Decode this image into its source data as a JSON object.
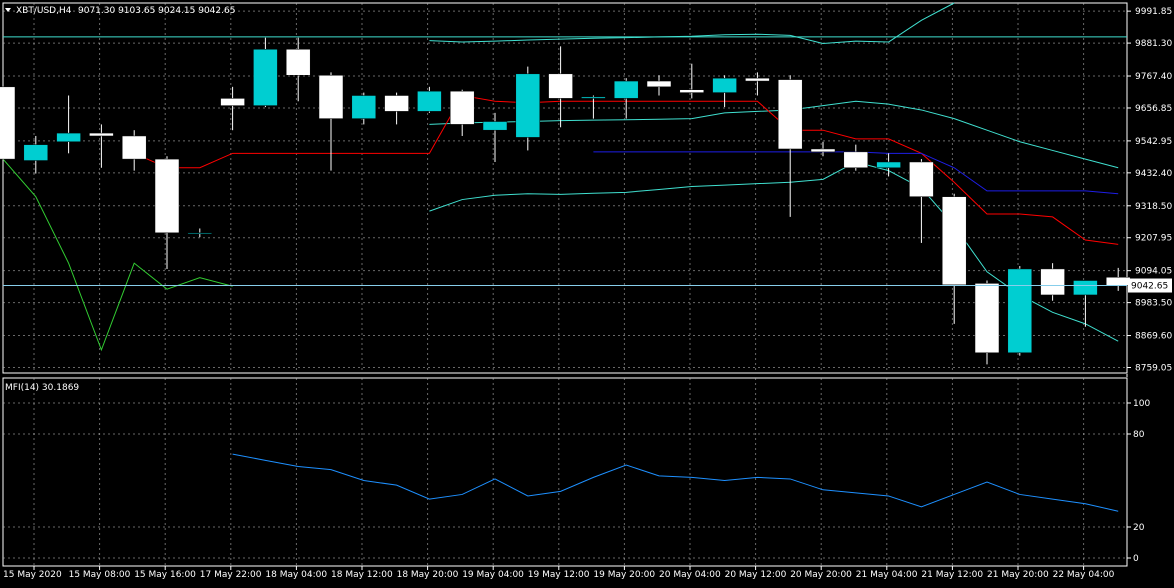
{
  "header": {
    "symbol": "XBT/USD,H4",
    "ohlc": "9071.30 9103.65 9024.15 9042.65",
    "menu_icon": "triangle-down-icon"
  },
  "indicator": {
    "label": "MFI(14) 30.1869",
    "levels": [
      100,
      80,
      20,
      0
    ],
    "level_labels": [
      "100",
      "80",
      "20",
      "0"
    ]
  },
  "colors": {
    "background": "#000000",
    "grid": "#c0c0c0",
    "candle_up": "#00ced1",
    "candle_down": "#ffffff",
    "bollinger": "#40e0d0",
    "lime_line": "#32cd32",
    "red_line": "#ff0000",
    "blue_line": "#1e1ee6",
    "mfi_line": "#1e90ff",
    "current_price_line": "#87ceeb"
  },
  "chart_data": [
    {
      "type": "candlestick",
      "title": "XBT/USD,H4",
      "ylim": [
        8740,
        10020
      ],
      "y_ticks": [
        "9991.85",
        "9881.30",
        "9767.40",
        "9656.85",
        "9542.95",
        "9432.40",
        "9318.50",
        "9207.95",
        "9094.05",
        "8983.50",
        "8869.60",
        "8759.05"
      ],
      "current_price": "9042.65",
      "x_ticks": [
        "15 May 2020",
        "15 May 08:00",
        "15 May 16:00",
        "17 May 22:00",
        "18 May 04:00",
        "18 May 12:00",
        "18 May 20:00",
        "19 May 04:00",
        "19 May 12:00",
        "19 May 20:00",
        "20 May 04:00",
        "20 May 12:00",
        "20 May 20:00",
        "21 May 04:00",
        "21 May 12:00",
        "21 May 20:00",
        "22 May 04:00"
      ],
      "candles": [
        {
          "o": 9730,
          "h": 9750,
          "l": 9460,
          "c": 9480
        },
        {
          "o": 9475,
          "h": 9560,
          "l": 9430,
          "c": 9530
        },
        {
          "o": 9540,
          "h": 9700,
          "l": 9500,
          "c": 9570
        },
        {
          "o": 9570,
          "h": 9600,
          "l": 9450,
          "c": 9560
        },
        {
          "o": 9560,
          "h": 9580,
          "l": 9440,
          "c": 9480
        },
        {
          "o": 9480,
          "h": 9490,
          "l": 9100,
          "c": 9225
        },
        {
          "o": 9225,
          "h": 9240,
          "l": 9210,
          "c": 9225
        },
        {
          "o": 9690,
          "h": 9730,
          "l": 9580,
          "c": 9665
        },
        {
          "o": 9665,
          "h": 9900,
          "l": 9660,
          "c": 9860
        },
        {
          "o": 9860,
          "h": 9900,
          "l": 9680,
          "c": 9770
        },
        {
          "o": 9770,
          "h": 9780,
          "l": 9440,
          "c": 9620
        },
        {
          "o": 9620,
          "h": 9710,
          "l": 9600,
          "c": 9700
        },
        {
          "o": 9700,
          "h": 9710,
          "l": 9600,
          "c": 9645
        },
        {
          "o": 9645,
          "h": 9730,
          "l": 9640,
          "c": 9715
        },
        {
          "o": 9715,
          "h": 9720,
          "l": 9560,
          "c": 9600
        },
        {
          "o": 9580,
          "h": 9640,
          "l": 9470,
          "c": 9610
        },
        {
          "o": 9555,
          "h": 9800,
          "l": 9510,
          "c": 9775
        },
        {
          "o": 9775,
          "h": 9870,
          "l": 9590,
          "c": 9690
        },
        {
          "o": 9690,
          "h": 9700,
          "l": 9620,
          "c": 9695
        },
        {
          "o": 9690,
          "h": 9760,
          "l": 9620,
          "c": 9750
        },
        {
          "o": 9750,
          "h": 9770,
          "l": 9700,
          "c": 9730
        },
        {
          "o": 9720,
          "h": 9810,
          "l": 9690,
          "c": 9710
        },
        {
          "o": 9710,
          "h": 9770,
          "l": 9660,
          "c": 9760
        },
        {
          "o": 9760,
          "h": 9780,
          "l": 9700,
          "c": 9750
        },
        {
          "o": 9755,
          "h": 9770,
          "l": 9280,
          "c": 9515
        },
        {
          "o": 9515,
          "h": 9540,
          "l": 9490,
          "c": 9505
        },
        {
          "o": 9505,
          "h": 9530,
          "l": 9440,
          "c": 9450
        },
        {
          "o": 9450,
          "h": 9500,
          "l": 9420,
          "c": 9470
        },
        {
          "o": 9470,
          "h": 9480,
          "l": 9190,
          "c": 9350
        },
        {
          "o": 9350,
          "h": 9360,
          "l": 8910,
          "c": 9045
        },
        {
          "o": 9050,
          "h": 9060,
          "l": 8770,
          "c": 8810
        },
        {
          "o": 8810,
          "h": 9110,
          "l": 8800,
          "c": 9100
        },
        {
          "o": 9100,
          "h": 9120,
          "l": 8990,
          "c": 9010
        },
        {
          "o": 9010,
          "h": 9060,
          "l": 8900,
          "c": 9060
        },
        {
          "o": 9071.3,
          "h": 9103.65,
          "l": 9024.15,
          "c": 9042.65
        }
      ],
      "series": [
        {
          "color": "#40e0d0",
          "values": [
            null,
            null,
            null,
            null,
            null,
            null,
            null,
            null,
            null,
            null,
            null,
            null,
            null,
            9890,
            9885,
            9888,
            9892,
            9895,
            9898,
            9900,
            9903,
            9905,
            9910,
            9912,
            9908,
            9880,
            9888,
            9885,
            9960,
            10050,
            null,
            null,
            null,
            null,
            null
          ]
        },
        {
          "color": "#40e0d0",
          "values": [
            null,
            null,
            null,
            null,
            null,
            null,
            null,
            null,
            null,
            null,
            null,
            null,
            null,
            9600,
            9605,
            9608,
            9610,
            9613,
            9615,
            9616,
            9618,
            9620,
            9640,
            9645,
            9650,
            9665,
            9680,
            9670,
            9650,
            9620,
            9580,
            9540,
            9510,
            9480,
            9450
          ]
        },
        {
          "color": "#40e0d0",
          "values": [
            null,
            null,
            null,
            null,
            null,
            null,
            null,
            null,
            null,
            null,
            null,
            null,
            null,
            9300,
            9340,
            9355,
            9360,
            9358,
            9362,
            9365,
            9375,
            9385,
            9390,
            9395,
            9400,
            9410,
            9470,
            9440,
            9380,
            9250,
            9090,
            9010,
            8950,
            8910,
            8850
          ]
        },
        {
          "color": "#32cd32",
          "values": [
            9480,
            9350,
            9120,
            8820,
            9120,
            9030,
            9070,
            9040,
            null,
            null,
            null,
            null,
            null,
            null,
            null,
            null,
            null,
            null,
            null,
            null,
            null,
            null,
            null,
            null,
            null,
            null,
            null,
            null,
            null,
            null,
            null,
            null,
            null,
            null,
            null
          ]
        },
        {
          "color": "#ff0000",
          "values": [
            null,
            null,
            null,
            null,
            9500,
            9450,
            9450,
            9500,
            9500,
            9500,
            9500,
            9500,
            9500,
            9500,
            9700,
            9680,
            9675,
            9680,
            9680,
            9680,
            9680,
            9680,
            9680,
            9680,
            9580,
            9580,
            9550,
            9550,
            9500,
            9400,
            9290,
            9290,
            9280,
            9200,
            9185
          ]
        },
        {
          "color": "#1e1ee6",
          "values": [
            null,
            null,
            null,
            null,
            null,
            null,
            null,
            null,
            null,
            null,
            null,
            null,
            null,
            null,
            null,
            null,
            null,
            null,
            9505,
            9505,
            9505,
            9505,
            9505,
            9505,
            9505,
            9505,
            9505,
            9500,
            9500,
            9450,
            9370,
            9370,
            9370,
            9370,
            9360
          ]
        }
      ]
    },
    {
      "type": "line",
      "title": "MFI(14) 30.1869",
      "ylim": [
        0,
        100
      ],
      "series": [
        {
          "color": "#1e90ff",
          "values": [
            null,
            null,
            null,
            null,
            null,
            null,
            null,
            67,
            63,
            59,
            57,
            50,
            47,
            38,
            41,
            51,
            40,
            43,
            52,
            60,
            53,
            52,
            50,
            52,
            51,
            44,
            42,
            40,
            33,
            41,
            49,
            41,
            38,
            35,
            30.1869
          ]
        }
      ]
    }
  ]
}
